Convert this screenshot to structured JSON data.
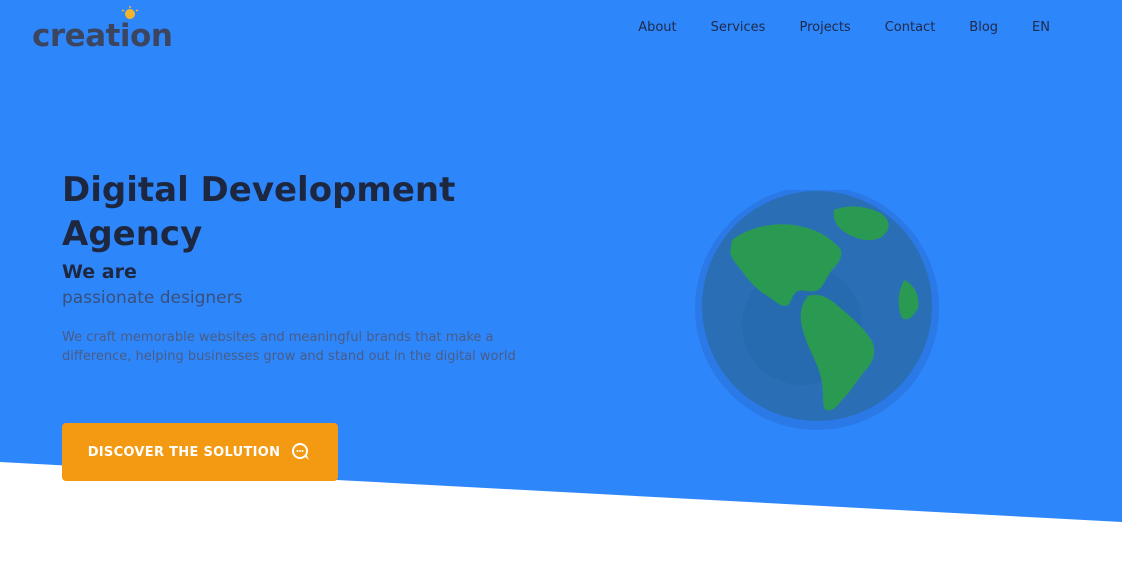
{
  "header": {
    "logo_text": "creation",
    "nav": [
      "About",
      "Services",
      "Projects",
      "Contact",
      "Blog",
      "EN"
    ]
  },
  "hero": {
    "title": "Digital Development Agency",
    "subtitle": "We are",
    "subtitle2": "passionate designers",
    "description": "We craft memorable websites and meaningful brands that make a difference, helping businesses grow and stand out in the digital world",
    "cta_label": "DISCOVER THE SOLUTION"
  },
  "colors": {
    "background": "#2e86fb",
    "accent": "#f39a12",
    "globe_ocean": "#2a6fb6",
    "globe_land": "#2a9a52"
  },
  "icons": {
    "logo_mark": "lightbulb-icon",
    "cta_icon": "chat-bubble-icon",
    "hero_image": "globe-icon"
  }
}
